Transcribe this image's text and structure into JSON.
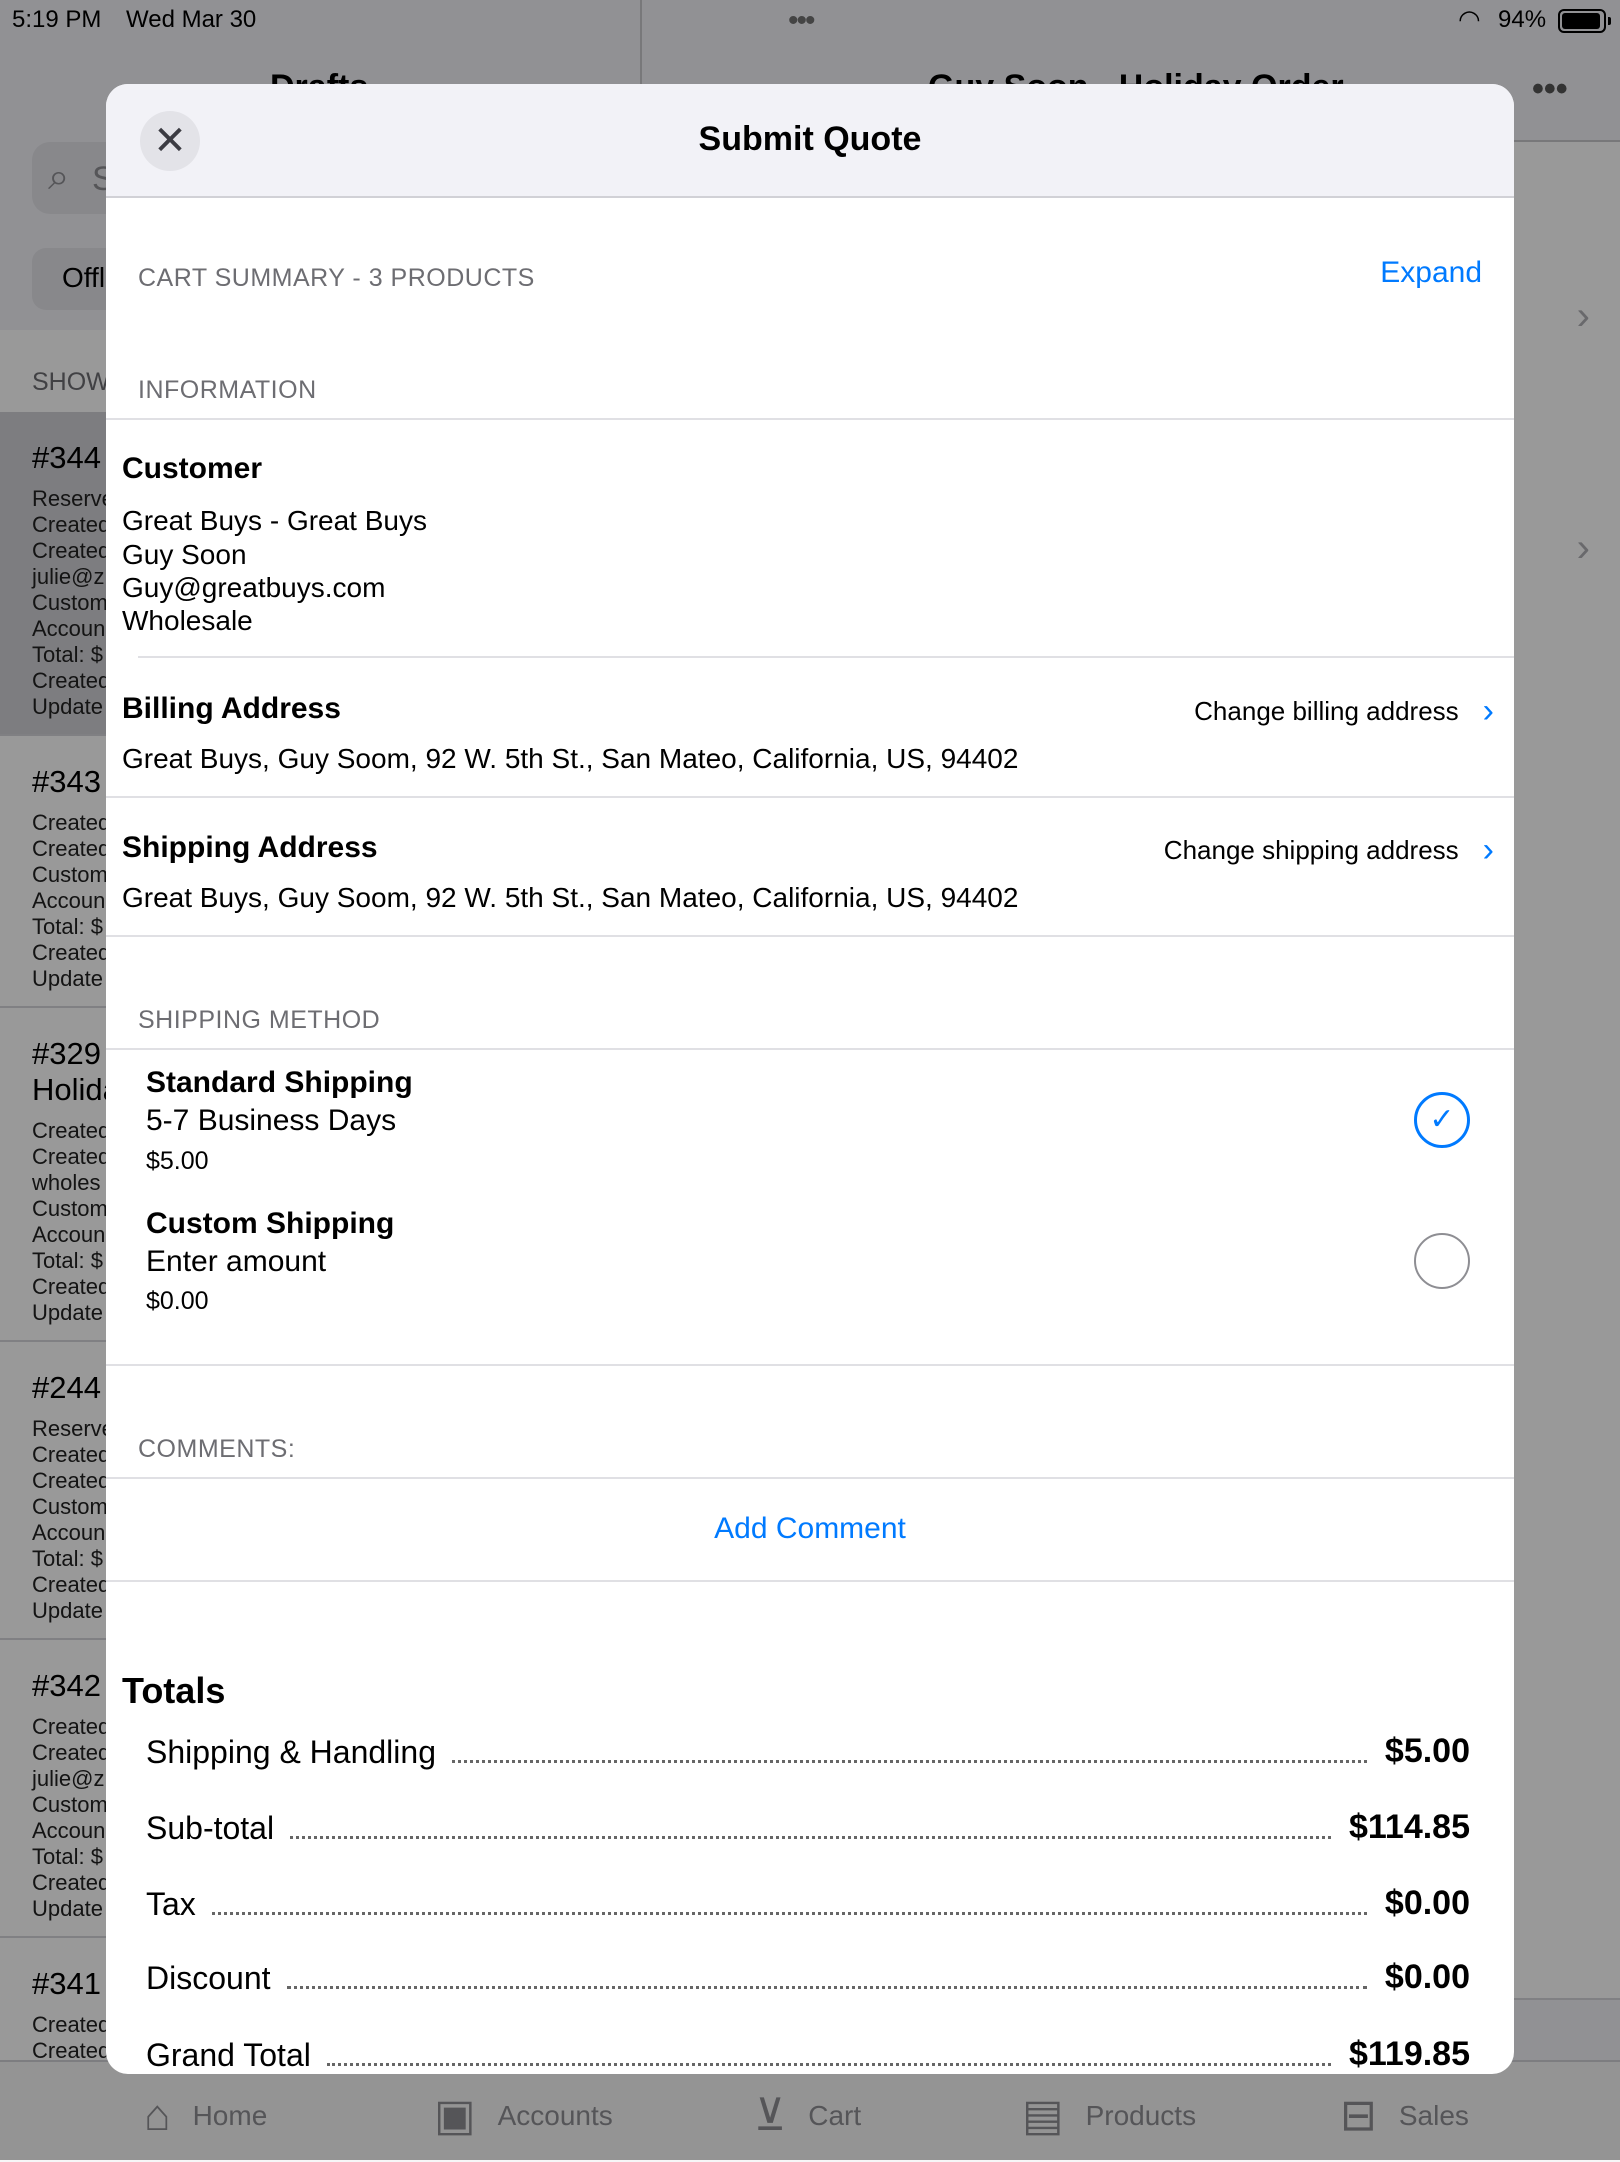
{
  "status_bar": {
    "time": "5:19 PM",
    "date": "Wed Mar 30",
    "battery": "94%"
  },
  "background": {
    "left_title": "Drafts",
    "search_placeholder": "S",
    "filter_chip": "Offl",
    "show_label": "SHOW",
    "right_title": "Guy Soon - Holiday Order",
    "list": [
      {
        "number": "#344",
        "lines": [
          "Reserve",
          "Created",
          "Created",
          "julie@z",
          "Custom",
          "Accoun",
          "Total: $",
          "Created",
          "Update"
        ]
      },
      {
        "number": "#343",
        "lines": [
          "Created",
          "Created",
          "Custom",
          "Accoun",
          "Total: $",
          "Created",
          "Update"
        ]
      },
      {
        "number": "#329",
        "subtitle": "Holida",
        "lines": [
          "Created",
          "Created",
          "wholes",
          "Custom",
          "Accoun",
          "Total: $",
          "Created",
          "Update"
        ]
      },
      {
        "number": "#244",
        "lines": [
          "Reserve",
          "Created",
          "Created",
          "Custom",
          "Accoun",
          "Total: $",
          "Created",
          "Update"
        ]
      },
      {
        "number": "#342",
        "lines": [
          "Created",
          "Created",
          "julie@z",
          "Custom",
          "Accoun",
          "Total: $",
          "Created",
          "Update"
        ]
      },
      {
        "number": "#341",
        "lines": [
          "Created",
          "Created"
        ]
      }
    ]
  },
  "modal": {
    "title": "Submit Quote",
    "cart_summary": {
      "label": "CART SUMMARY - 3 PRODUCTS",
      "expand_label": "Expand"
    },
    "information": {
      "label": "INFORMATION",
      "customer": {
        "title": "Customer",
        "company": "Great Buys - Great Buys",
        "name": "Guy Soon",
        "email": "Guy@greatbuys.com",
        "price_level": "Wholesale"
      },
      "billing": {
        "title": "Billing Address",
        "change_label": "Change billing address",
        "address": "Great Buys, Guy Soom, 92 W. 5th St., San Mateo, California, US, 94402"
      },
      "shipping": {
        "title": "Shipping Address",
        "change_label": "Change shipping address",
        "address": "Great Buys, Guy Soom, 92 W. 5th St., San Mateo, California, US, 94402"
      }
    },
    "shipping_method": {
      "label": "SHIPPING METHOD",
      "options": [
        {
          "name": "Standard Shipping",
          "description": "5-7 Business Days",
          "price": "$5.00",
          "selected": true
        },
        {
          "name": "Custom Shipping",
          "description": "Enter amount",
          "price": "$0.00",
          "selected": false
        }
      ]
    },
    "comments": {
      "label": "COMMENTS:",
      "add_label": "Add Comment"
    },
    "totals": {
      "title": "Totals",
      "rows": [
        {
          "label": "Shipping & Handling",
          "value": "$5.00"
        },
        {
          "label": "Sub-total",
          "value": "$114.85"
        },
        {
          "label": "Tax",
          "value": "$0.00"
        },
        {
          "label": "Discount",
          "value": "$0.00"
        },
        {
          "label": "Grand Total",
          "value": "$119.85"
        }
      ]
    }
  },
  "tab_bar": [
    {
      "label": "Home",
      "icon": "home-icon"
    },
    {
      "label": "Accounts",
      "icon": "person-card-icon"
    },
    {
      "label": "Cart",
      "icon": "cart-icon"
    },
    {
      "label": "Products",
      "icon": "archive-box-icon"
    },
    {
      "label": "Sales",
      "icon": "tray-icon"
    }
  ],
  "colors": {
    "accent": "#007aff",
    "header_bg": "#f2f2f7",
    "dim_overlay": "rgba(0,0,0,0.40)"
  }
}
